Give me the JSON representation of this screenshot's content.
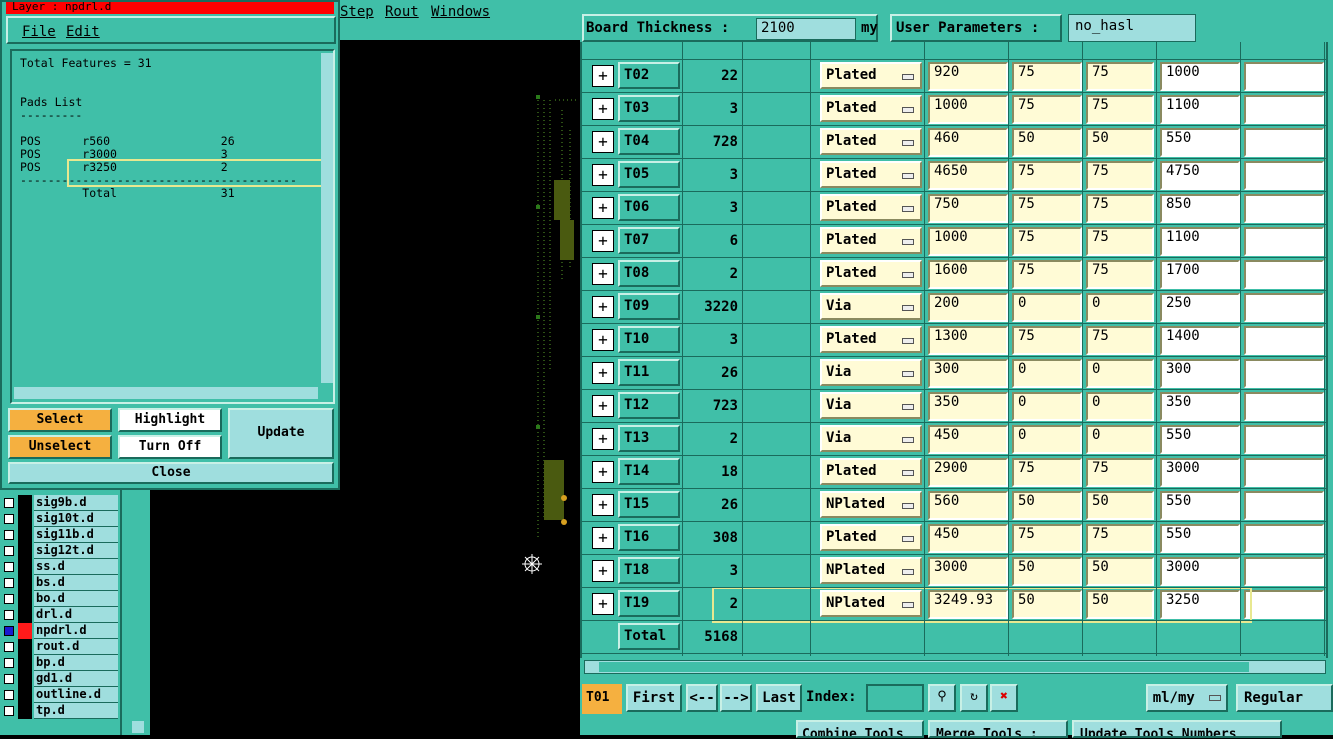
{
  "features_window": {
    "title": "Layer : npdrl.d",
    "menu": {
      "file": "File",
      "edit": "Edit"
    },
    "report_lines": [
      "Total Features = 31",
      "",
      "",
      "Pads List",
      "---------",
      "",
      "POS      r560                26",
      "POS      r3000               3",
      "POS      r3250               2",
      "----------------------------------------",
      "         Total               31"
    ],
    "buttons": {
      "select": "Select",
      "highlight": "Highlight",
      "unselect": "Unselect",
      "turn_off": "Turn Off",
      "update": "Update",
      "close": "Close"
    }
  },
  "top_menu": [
    "Step",
    "Rout",
    "Windows"
  ],
  "layers": [
    {
      "name": "sig9b.d",
      "active": false
    },
    {
      "name": "sig10t.d",
      "active": false
    },
    {
      "name": "sig11b.d",
      "active": false
    },
    {
      "name": "sig12t.d",
      "active": false
    },
    {
      "name": "ss.d",
      "active": false
    },
    {
      "name": "bs.d",
      "active": false
    },
    {
      "name": "bo.d",
      "active": false
    },
    {
      "name": "drl.d",
      "active": false
    },
    {
      "name": "npdrl.d",
      "active": true
    },
    {
      "name": "rout.d",
      "active": false
    },
    {
      "name": "bp.d",
      "active": false
    },
    {
      "name": "gd1.d",
      "active": false
    },
    {
      "name": "outline.d",
      "active": false
    },
    {
      "name": "tp.d",
      "active": false
    }
  ],
  "drill_window": {
    "board_thickness_label": "Board Thickness :",
    "board_thickness_value": "2100",
    "board_thickness_unit": "my",
    "user_params_label": "User Parameters :",
    "user_params_value": "no_hasl",
    "rows": [
      {
        "tool": "T02",
        "count": "22",
        "type": "Plated",
        "v1": "920",
        "v2": "75",
        "v3": "75",
        "v4": "1000"
      },
      {
        "tool": "T03",
        "count": "3",
        "type": "Plated",
        "v1": "1000",
        "v2": "75",
        "v3": "75",
        "v4": "1100"
      },
      {
        "tool": "T04",
        "count": "728",
        "type": "Plated",
        "v1": "460",
        "v2": "50",
        "v3": "50",
        "v4": "550"
      },
      {
        "tool": "T05",
        "count": "3",
        "type": "Plated",
        "v1": "4650",
        "v2": "75",
        "v3": "75",
        "v4": "4750"
      },
      {
        "tool": "T06",
        "count": "3",
        "type": "Plated",
        "v1": "750",
        "v2": "75",
        "v3": "75",
        "v4": "850"
      },
      {
        "tool": "T07",
        "count": "6",
        "type": "Plated",
        "v1": "1000",
        "v2": "75",
        "v3": "75",
        "v4": "1100"
      },
      {
        "tool": "T08",
        "count": "2",
        "type": "Plated",
        "v1": "1600",
        "v2": "75",
        "v3": "75",
        "v4": "1700"
      },
      {
        "tool": "T09",
        "count": "3220",
        "type": "Via",
        "v1": "200",
        "v2": "0",
        "v3": "0",
        "v4": "250"
      },
      {
        "tool": "T10",
        "count": "3",
        "type": "Plated",
        "v1": "1300",
        "v2": "75",
        "v3": "75",
        "v4": "1400"
      },
      {
        "tool": "T11",
        "count": "26",
        "type": "Via",
        "v1": "300",
        "v2": "0",
        "v3": "0",
        "v4": "300"
      },
      {
        "tool": "T12",
        "count": "723",
        "type": "Via",
        "v1": "350",
        "v2": "0",
        "v3": "0",
        "v4": "350"
      },
      {
        "tool": "T13",
        "count": "2",
        "type": "Via",
        "v1": "450",
        "v2": "0",
        "v3": "0",
        "v4": "550"
      },
      {
        "tool": "T14",
        "count": "18",
        "type": "Plated",
        "v1": "2900",
        "v2": "75",
        "v3": "75",
        "v4": "3000"
      },
      {
        "tool": "T15",
        "count": "26",
        "type": "NPlated",
        "v1": "560",
        "v2": "50",
        "v3": "50",
        "v4": "550"
      },
      {
        "tool": "T16",
        "count": "308",
        "type": "Plated",
        "v1": "450",
        "v2": "75",
        "v3": "75",
        "v4": "550"
      },
      {
        "tool": "T18",
        "count": "3",
        "type": "NPlated",
        "v1": "3000",
        "v2": "50",
        "v3": "50",
        "v4": "3000"
      },
      {
        "tool": "T19",
        "count": "2",
        "type": "NPlated",
        "v1": "3249.93",
        "v2": "50",
        "v3": "50",
        "v4": "3250"
      }
    ],
    "total_label": "Total",
    "total_count": "5168",
    "bottom": {
      "current_tool": "T01",
      "first": "First",
      "prev": "<--",
      "next": "-->",
      "last": "Last",
      "index_label": "Index:",
      "units": "ml/my",
      "mode": "Regular"
    },
    "footer_buttons": [
      "Combine Tools",
      "Merge Tools :",
      "Update Tools Numbers"
    ]
  },
  "colors": {
    "panel": "#40bfa8",
    "active_layer": "#ff1a1a",
    "title_bar": "#ff0000",
    "select_button": "#f5b040"
  }
}
